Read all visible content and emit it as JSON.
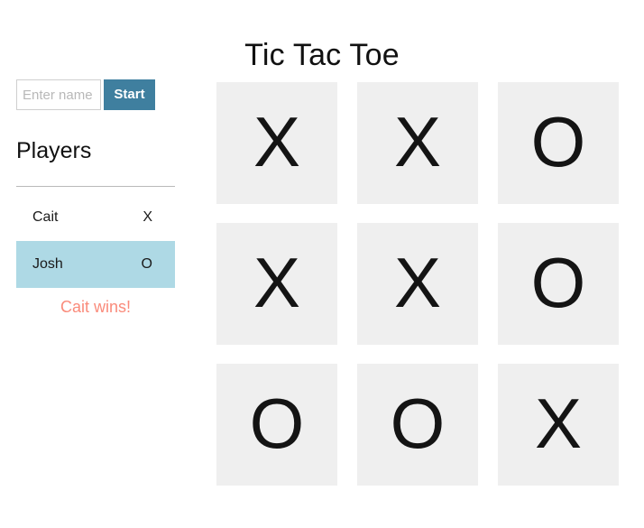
{
  "app": {
    "title": "Tic Tac Toe"
  },
  "sidebar": {
    "name_input": {
      "placeholder": "Enter name",
      "value": ""
    },
    "start_button_label": "Start",
    "players_heading": "Players",
    "players": [
      {
        "name": "Cait",
        "symbol": "X",
        "active": false
      },
      {
        "name": "Josh",
        "symbol": "O",
        "active": true
      }
    ],
    "status_message": "Cait wins!"
  },
  "board": {
    "cells": [
      {
        "mark": "X"
      },
      {
        "mark": "X"
      },
      {
        "mark": "O"
      },
      {
        "mark": "X"
      },
      {
        "mark": "X"
      },
      {
        "mark": "O"
      },
      {
        "mark": "O"
      },
      {
        "mark": "O"
      },
      {
        "mark": "X"
      }
    ]
  },
  "colors": {
    "accent_button": "#3f7f9f",
    "active_row": "#aed9e5",
    "cell_background": "#efefef",
    "status_text": "#fa8b7b",
    "page_background": "#ffffff"
  }
}
